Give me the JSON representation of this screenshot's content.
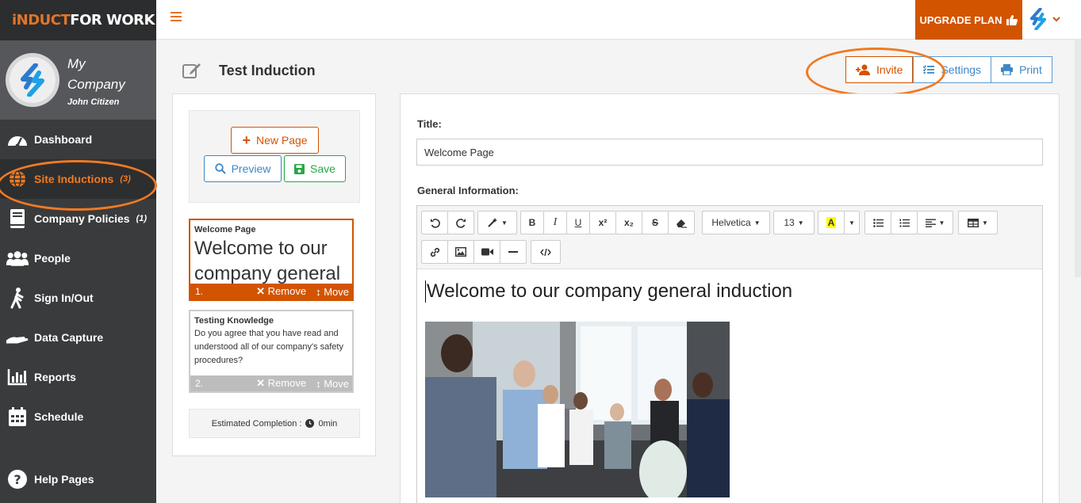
{
  "brand": {
    "logo_part1": "iNDUCT",
    "logo_part2": "FOR WORK"
  },
  "company": {
    "name": "My Company",
    "user": "John Citizen"
  },
  "nav": [
    {
      "label": "Dashboard",
      "icon": "dashboard-icon"
    },
    {
      "label": "Site Inductions",
      "count": "(3)",
      "icon": "globe-icon",
      "active": true
    },
    {
      "label": "Company Policies",
      "count": "(1)",
      "icon": "book-icon"
    },
    {
      "label": "People",
      "icon": "people-icon"
    },
    {
      "label": "Sign In/Out",
      "icon": "walking-icon"
    },
    {
      "label": "Data Capture",
      "icon": "hand-icon"
    },
    {
      "label": "Reports",
      "icon": "bar-chart-icon"
    },
    {
      "label": "Schedule",
      "icon": "calendar-icon"
    },
    {
      "label": "Help Pages",
      "icon": "question-icon"
    }
  ],
  "topbar": {
    "upgrade_label": "UPGRADE PLAN"
  },
  "page": {
    "title": "Test Induction"
  },
  "header_buttons": {
    "invite": "Invite",
    "settings": "Settings",
    "print": "Print"
  },
  "left_panel": {
    "new_page": "New Page",
    "preview": "Preview",
    "save": "Save",
    "cards": [
      {
        "title": "Welcome Page",
        "preview": "Welcome to our company general induction",
        "number": "1.",
        "remove": "Remove",
        "move": "Move"
      },
      {
        "title": "Testing Knowledge",
        "preview": "Do you agree that you have read and understood all of our company's safety procedures?",
        "number": "2.",
        "remove": "Remove",
        "move": "Move"
      }
    ],
    "estimate_label": "Estimated Completion :",
    "estimate_value": "0min"
  },
  "editor": {
    "title_label": "Title:",
    "title_value": "Welcome Page",
    "info_label": "General Information:",
    "font_name": "Helvetica",
    "font_size": "13",
    "superscript": "x²",
    "subscript": "x₂",
    "content_heading": "Welcome to our company general induction"
  },
  "colors": {
    "accent": "#d35400",
    "sidebar": "#3a3b3c",
    "link": "#3d87c9",
    "success": "#28a745"
  }
}
